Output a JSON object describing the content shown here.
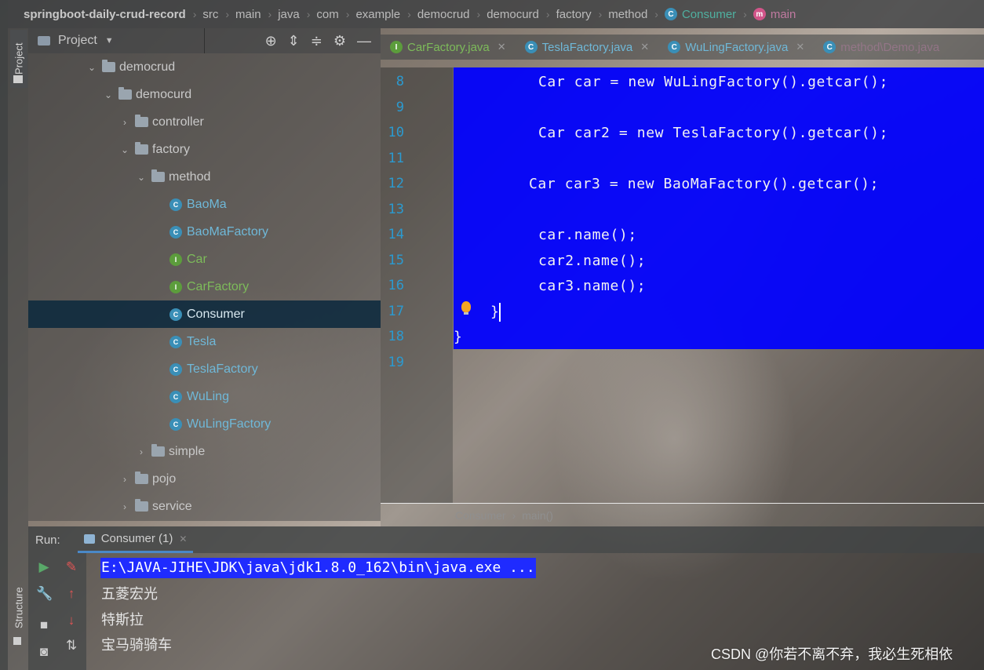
{
  "breadcrumb": {
    "project": "springboot-daily-crud-record",
    "parts": [
      "src",
      "main",
      "java",
      "com",
      "example",
      "democrud",
      "democurd",
      "factory",
      "method"
    ],
    "class_name": "Consumer",
    "method_name": "main"
  },
  "project_panel": {
    "title": "Project",
    "tree": [
      {
        "label": "democrud",
        "kind": "folder",
        "arrow": "expanded"
      },
      {
        "label": "democurd",
        "kind": "folder",
        "arrow": "expanded"
      },
      {
        "label": "controller",
        "kind": "folder",
        "arrow": "collapsed"
      },
      {
        "label": "factory",
        "kind": "folder",
        "arrow": "expanded"
      },
      {
        "label": "method",
        "kind": "folder",
        "arrow": "expanded"
      },
      {
        "label": "BaoMa",
        "kind": "class"
      },
      {
        "label": "BaoMaFactory",
        "kind": "class"
      },
      {
        "label": "Car",
        "kind": "interface"
      },
      {
        "label": "CarFactory",
        "kind": "interface"
      },
      {
        "label": "Consumer",
        "kind": "class",
        "selected": true
      },
      {
        "label": "Tesla",
        "kind": "class"
      },
      {
        "label": "TeslaFactory",
        "kind": "class"
      },
      {
        "label": "WuLing",
        "kind": "class"
      },
      {
        "label": "WuLingFactory",
        "kind": "class"
      },
      {
        "label": "simple",
        "kind": "folder",
        "arrow": "collapsed"
      },
      {
        "label": "pojo",
        "kind": "folder",
        "arrow": "collapsed"
      },
      {
        "label": "service",
        "kind": "folder",
        "arrow": "collapsed"
      }
    ]
  },
  "editor_tabs": [
    {
      "label": "CarFactory.java",
      "kind": "interface"
    },
    {
      "label": "TeslaFactory.java",
      "kind": "class"
    },
    {
      "label": "WuLingFactory.java",
      "kind": "class"
    }
  ],
  "editor_tab_overflow": "method\\Demo.java",
  "code": {
    "line_numbers": [
      "8",
      "9",
      "10",
      "11",
      "12",
      "13",
      "14",
      "15",
      "16",
      "17",
      "18",
      "19"
    ],
    "lines": {
      "l8": "Car car = new WuLingFactory().getcar();",
      "l10": "Car car2 = new TeslaFactory().getcar();",
      "l12": "Car car3 = new BaoMaFactory().getcar();",
      "l14": "car.name();",
      "l15": "car2.name();",
      "l16": "car3.name();",
      "l17": "}",
      "l18": "}"
    }
  },
  "editor_footer": {
    "class_name": "Consumer",
    "method": "main()"
  },
  "run_panel": {
    "label": "Run:",
    "tab": "Consumer (1)",
    "command": "E:\\JAVA-JIHE\\JDK\\java\\jdk1.8.0_162\\bin\\java.exe ...",
    "output": [
      "五菱宏光",
      "特斯拉",
      "宝马骑骑车"
    ]
  },
  "side_tabs": {
    "project": "Project",
    "structure": "Structure"
  },
  "watermark": "CSDN @你若不离不弃，我必生死相依",
  "colors": {
    "selection": "#0000ff",
    "line_numbers": "#2b9ad0",
    "selected_row": "#0d293e"
  }
}
